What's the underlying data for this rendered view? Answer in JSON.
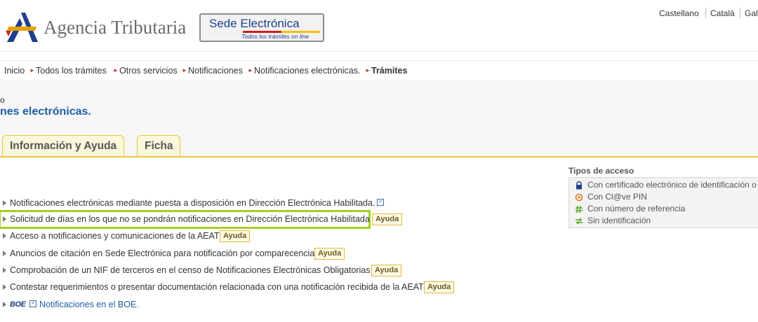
{
  "header": {
    "logo_text": "Agencia Tributaria",
    "sede_title": "Sede Electrónica",
    "sede_subtitle": "Todos los trámites on line",
    "languages": [
      "Castellano",
      "Català",
      "Gal"
    ]
  },
  "breadcrumb": [
    "Inicio",
    "Todos los trámites",
    "Otros servicios",
    "Notificaciones",
    "Notificaciones electrónicas.",
    "Trámites"
  ],
  "page": {
    "small_heading": "o",
    "title": "nes electrónicas."
  },
  "tabs": [
    "Información y Ayuda",
    "Ficha"
  ],
  "items": [
    {
      "text": "Notificaciones electrónicas mediante puesta a disposición en Dirección Electrónica Habilitada.",
      "ayuda": null,
      "external": true
    },
    {
      "text": "Solicitud de días en los que no se pondrán notificaciones en Dirección Electrónica Habilitada",
      "ayuda": "Ayuda",
      "external": false
    },
    {
      "text": "Acceso a notificaciones y comunicaciones de la AEAT",
      "ayuda": "Ayuda",
      "external": false
    },
    {
      "text": "Anuncios de citación en Sede Electrónica para notificación por comparecencia",
      "ayuda": "Ayuda",
      "external": false
    },
    {
      "text": "Comprobación de un NIF de terceros en el censo de Notificaciones Electrónicas Obligatorias",
      "ayuda": "Ayuda",
      "external": false
    },
    {
      "text": "Contestar requerimientos o presentar documentación relacionada con una notificación recibida de la AEAT",
      "ayuda": "Ayuda",
      "external": false
    },
    {
      "text": "Notificaciones en el BOE.",
      "ayuda": null,
      "external": true,
      "badge": "BOE"
    }
  ],
  "access": {
    "title": "Tipos de acceso",
    "types": [
      {
        "icon": "lock-icon",
        "label": "Con certificado electrónico de identificación o"
      },
      {
        "icon": "clave-icon",
        "label": "Con Cl@ve PIN"
      },
      {
        "icon": "hash-icon",
        "label": "Con número de referencia"
      },
      {
        "icon": "arrows-icon",
        "label": "Sin identificación"
      }
    ]
  },
  "colors": {
    "accent_yellow": "#e9c83a",
    "title_blue": "#1f5fa8",
    "highlight_green": "#a3d11b"
  }
}
